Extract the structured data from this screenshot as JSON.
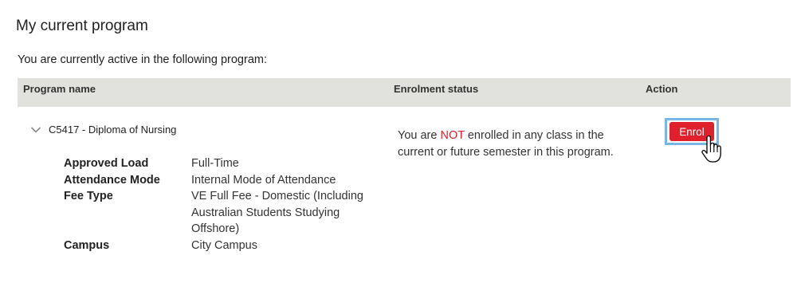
{
  "page": {
    "title": "My current program",
    "intro": "You are currently active in the following program:"
  },
  "table": {
    "headers": {
      "program_name": "Program name",
      "enrolment_status": "Enrolment status",
      "action": "Action"
    },
    "program": {
      "name": "C5417 - Diploma of Nursing",
      "details": [
        {
          "label": "Approved Load",
          "value": "Full-Time"
        },
        {
          "label": "Attendance Mode",
          "value": "Internal Mode of Attendance"
        },
        {
          "label": "Fee Type",
          "value": "VE Full Fee - Domestic (Including Australian Students Studying Offshore)"
        },
        {
          "label": "Campus",
          "value": "City Campus"
        }
      ],
      "status": {
        "prefix": "You are ",
        "emphasis": "NOT",
        "suffix": " enrolled in any class in the current or future semester in this program."
      },
      "action_label": "Enrol"
    }
  },
  "colors": {
    "header_bg": "#e1e2de",
    "button_red": "#e0202c",
    "focus_blue": "#7ab7e8",
    "emphasis_red": "#e0222c"
  },
  "icons": {
    "chevron": "chevron-down-icon",
    "cursor": "hand-pointer-cursor-icon"
  }
}
